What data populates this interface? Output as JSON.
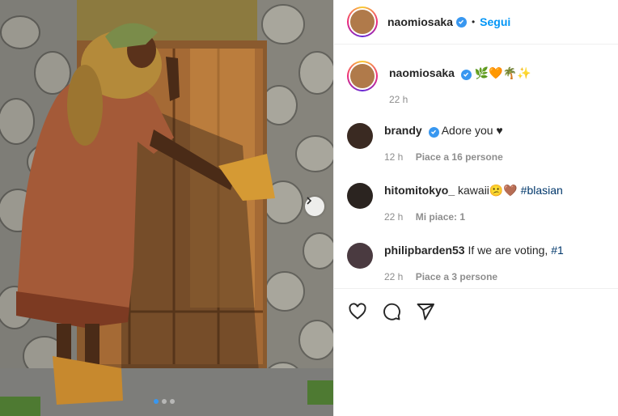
{
  "header": {
    "username": "naomiosaka",
    "separator": "•",
    "follow_label": "Segui"
  },
  "caption": {
    "username": "naomiosaka",
    "emojis": "🌿🧡🌴✨",
    "time": "22 h"
  },
  "comments": [
    {
      "username": "brandy",
      "verified": true,
      "text": "Adore you ♥",
      "time": "12 h",
      "likes": "Piace a 16 persone"
    },
    {
      "username": "hitomitokyo_",
      "verified": false,
      "text": "kawaii😕🤎 ",
      "hashtag": "#blasian",
      "time": "22 h",
      "likes": "Mi piace: 1"
    },
    {
      "username": "philipbarden53",
      "verified": false,
      "text": "If we are voting, ",
      "hashtag": "#1",
      "time": "22 h",
      "likes": "Piace a 3 persone"
    }
  ],
  "carousel": {
    "slides": 3,
    "active_index": 0
  },
  "colors": {
    "accent": "#0095f6",
    "verified": "#3897f0",
    "muted": "#8e8e8e"
  },
  "icons": [
    "heart-icon",
    "comment-icon",
    "share-icon",
    "verified-icon",
    "chevron-right-icon"
  ]
}
